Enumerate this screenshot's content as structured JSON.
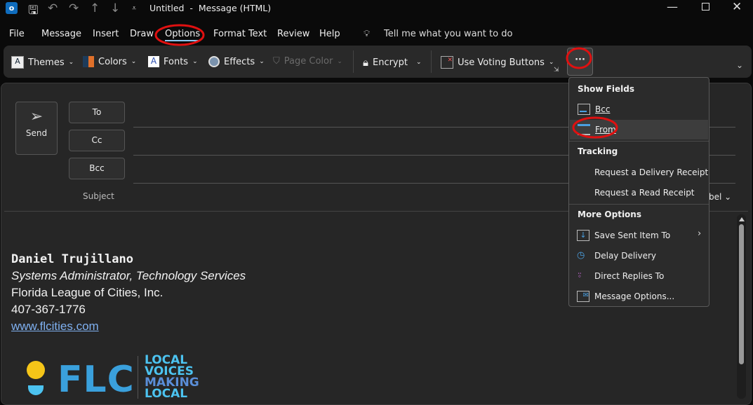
{
  "titlebar": {
    "title": "Untitled  -  Message (HTML)"
  },
  "menu": [
    "File",
    "Message",
    "Insert",
    "Draw",
    "Options",
    "Format Text",
    "Review",
    "Help"
  ],
  "tell_me": "Tell me what you want to do",
  "ribbon": {
    "themes": "Themes",
    "colors": "Colors",
    "fonts": "Fonts",
    "effects": "Effects",
    "page_color": "Page Color",
    "encrypt": "Encrypt",
    "voting": "Use Voting Buttons",
    "more": "···"
  },
  "compose": {
    "send": "Send",
    "to": "To",
    "cc": "Cc",
    "bcc": "Bcc",
    "subject": "Subject",
    "label_partial": "bel"
  },
  "dropdown": {
    "show_fields": "Show Fields",
    "bcc": "Bcc",
    "from": "From",
    "tracking": "Tracking",
    "delivery_receipt": "Request a Delivery Receipt",
    "read_receipt": "Request a Read Receipt",
    "more_options": "More Options",
    "save_sent": "Save Sent Item To",
    "delay": "Delay Delivery",
    "direct_replies": "Direct Replies To",
    "message_options": "Message Options..."
  },
  "signature": {
    "name": "Daniel Trujillano",
    "title": "Systems Administrator, Technology Services",
    "org": "Florida League of Cities, Inc.",
    "phone": "407-367-1776",
    "url": "www.flcities.com",
    "logo_text": "FLC",
    "tagline": [
      "LOCAL",
      "VOICES",
      "MAKING",
      "LOCAL"
    ]
  },
  "colors": {
    "accent": "#4aa3df",
    "annotation": "#e01010"
  }
}
